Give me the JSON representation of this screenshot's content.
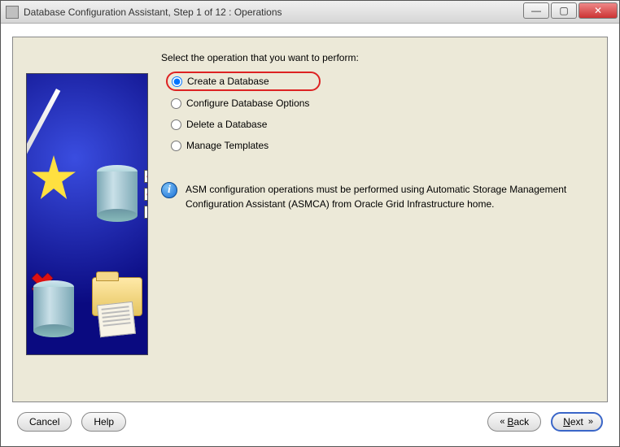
{
  "window": {
    "title": "Database Configuration Assistant, Step 1 of 12 : Operations"
  },
  "prompt": "Select the operation that you want to perform:",
  "options": {
    "create": {
      "label": "Create a Database",
      "selected": true
    },
    "configure": {
      "label": "Configure Database Options",
      "selected": false
    },
    "delete": {
      "label": "Delete a Database",
      "selected": false
    },
    "templates": {
      "label": "Manage Templates",
      "selected": false
    }
  },
  "info": {
    "text": "ASM configuration operations must be performed using Automatic Storage Management Configuration Assistant (ASMCA) from Oracle Grid Infrastructure home."
  },
  "buttons": {
    "cancel": "Cancel",
    "help": "Help",
    "back": "Back",
    "next": "Next"
  }
}
